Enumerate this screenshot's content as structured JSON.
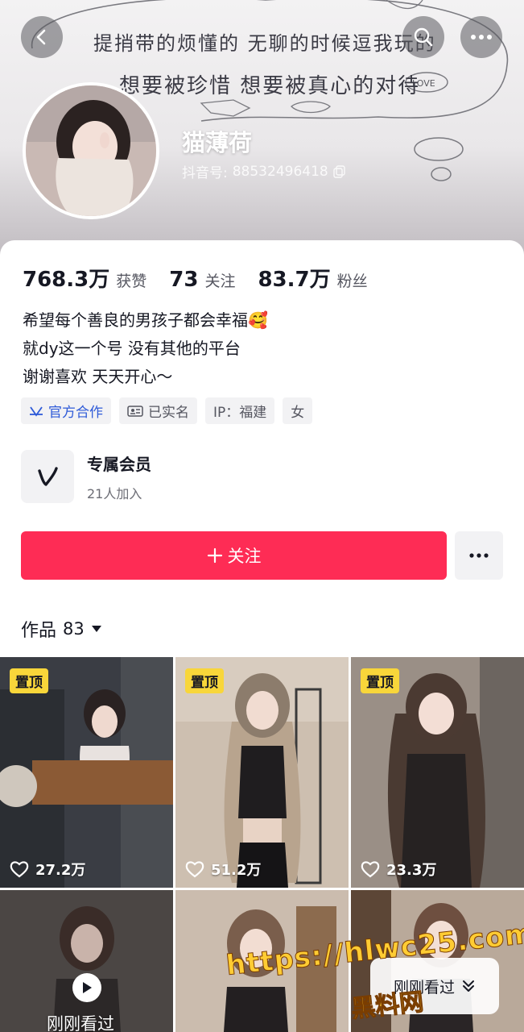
{
  "header": {
    "banner_lines": [
      "提捎带的烦懂的 无聊的时候逗我玩的",
      "想要被珍惜 想要被真心的对待"
    ],
    "nickname": "猫薄荷",
    "douyin_id_label": "抖音号:",
    "douyin_id": "88532496418"
  },
  "stats": {
    "likes_value": "768.3万",
    "likes_label": "获赞",
    "following_value": "73",
    "following_label": "关注",
    "followers_value": "83.7万",
    "followers_label": "粉丝"
  },
  "bio": {
    "line1": "希望每个善良的男孩子都会幸福🥰",
    "line2": "就dy这一个号 没有其他的平台",
    "line3": "谢谢喜欢 天天开心～"
  },
  "tags": {
    "official": "官方合作",
    "verified": "已实名",
    "ip": "IP：福建",
    "gender": "女"
  },
  "member": {
    "title": "专属会员",
    "subtitle": "21人加入"
  },
  "actions": {
    "follow_label": "关注"
  },
  "works": {
    "label": "作品",
    "count": "83"
  },
  "grid": {
    "pinned_label": "置顶",
    "tiles": [
      {
        "likes": "27.2万"
      },
      {
        "likes": "51.2万"
      },
      {
        "likes": "23.3万"
      }
    ],
    "recently_watched": "刚刚看过"
  },
  "watermark": {
    "url": "https://hlwc25.com",
    "name": "黑料网"
  },
  "colors": {
    "accent": "#fe2c55",
    "pin_badge": "#f8d63a",
    "official_blue": "#2f5bd8"
  }
}
